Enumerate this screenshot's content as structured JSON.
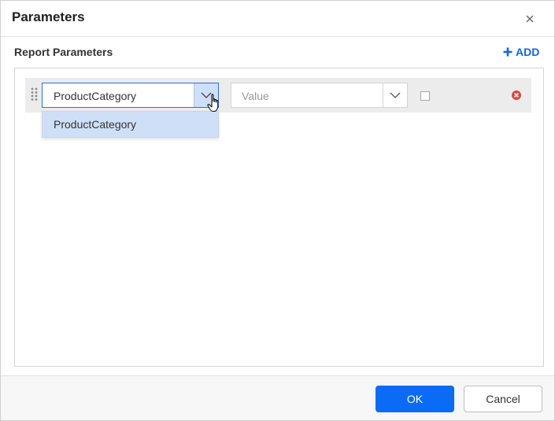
{
  "dialog": {
    "title": "Parameters",
    "close_icon": "close-icon"
  },
  "section": {
    "label": "Report Parameters",
    "add_label": "ADD",
    "add_icon": "plus-icon"
  },
  "parameter_row": {
    "name_value": "ProductCategory",
    "value_placeholder": "Value",
    "checkbox_checked": false,
    "drag_icon": "drag-handle-icon",
    "remove_icon": "remove-circle-icon"
  },
  "dropdown": {
    "options": [
      "ProductCategory"
    ],
    "selected": "ProductCategory"
  },
  "footer": {
    "ok_label": "OK",
    "cancel_label": "Cancel"
  },
  "colors": {
    "accent": "#0a6cf5",
    "link": "#1565e0",
    "selection": "#cfdff7",
    "remove": "#e0463c"
  }
}
